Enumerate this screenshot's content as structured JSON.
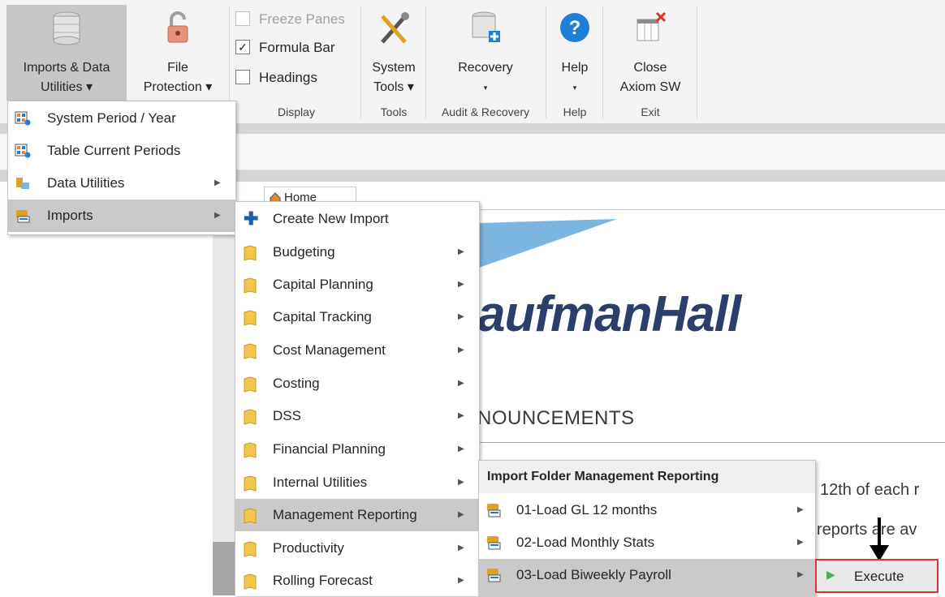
{
  "ribbon": {
    "imports_button": {
      "line1": "Imports & Data",
      "line2": "Utilities ▾",
      "icon": "database-icon"
    },
    "file_protection_button": {
      "line1": "File",
      "line2": "Protection ▾",
      "icon": "lock-icon"
    },
    "display": {
      "freeze_panes": {
        "label": "Freeze Panes",
        "checked": false
      },
      "formula_bar": {
        "label": "Formula Bar",
        "checked": true
      },
      "headings": {
        "label": "Headings",
        "checked": false
      },
      "group_label": "Display"
    },
    "system_tools_button": {
      "line1": "System",
      "line2": "Tools ▾",
      "icon": "tools-icon"
    },
    "tools_group_label": "Tools",
    "recovery_button": {
      "line1": "Recovery",
      "line2": "▾",
      "icon": "database-plus-icon"
    },
    "audit_group_label": "Audit & Recovery",
    "help_button": {
      "line1": "Help",
      "line2": "▾",
      "icon": "help-icon"
    },
    "help_group_label": "Help",
    "close_button": {
      "line1": "Close",
      "line2": "Axiom SW",
      "icon": "close-table-icon"
    },
    "exit_group_label": "Exit"
  },
  "content": {
    "home_tab": "Home",
    "logo_text": "aufmanHall",
    "announcements_title": "NOUNCEMENTS",
    "line1": "12th of each r",
    "line2": "reports are av"
  },
  "menu1": {
    "items": [
      {
        "label": "System Period / Year",
        "icon": "period-grid-icon",
        "submenu": false
      },
      {
        "label": "Table Current Periods",
        "icon": "period-grid-icon",
        "submenu": false
      },
      {
        "label": "Data Utilities",
        "icon": "data-utilities-icon",
        "submenu": true
      },
      {
        "label": "Imports",
        "icon": "imports-icon",
        "submenu": true,
        "selected": true
      }
    ]
  },
  "menu2": {
    "items": [
      {
        "label": "Create New Import",
        "icon": "plus-icon",
        "submenu": false
      },
      {
        "label": "Budgeting",
        "icon": "folder-icon",
        "submenu": true
      },
      {
        "label": "Capital Planning",
        "icon": "folder-icon",
        "submenu": true
      },
      {
        "label": "Capital Tracking",
        "icon": "folder-icon",
        "submenu": true
      },
      {
        "label": "Cost Management",
        "icon": "folder-icon",
        "submenu": true
      },
      {
        "label": "Costing",
        "icon": "folder-icon",
        "submenu": true
      },
      {
        "label": "DSS",
        "icon": "folder-icon",
        "submenu": true
      },
      {
        "label": "Financial Planning",
        "icon": "folder-icon",
        "submenu": true
      },
      {
        "label": "Internal Utilities",
        "icon": "folder-icon",
        "submenu": true
      },
      {
        "label": "Management Reporting",
        "icon": "folder-icon",
        "submenu": true,
        "selected": true
      },
      {
        "label": "Productivity",
        "icon": "folder-icon",
        "submenu": true
      },
      {
        "label": "Rolling Forecast",
        "icon": "folder-icon",
        "submenu": true
      }
    ]
  },
  "menu3": {
    "header": "Import Folder Management Reporting",
    "items": [
      {
        "label": "01-Load GL 12 months",
        "icon": "import-icon",
        "submenu": true
      },
      {
        "label": "02-Load Monthly Stats",
        "icon": "import-icon",
        "submenu": true
      },
      {
        "label": "03-Load Biweekly Payroll",
        "icon": "import-icon",
        "submenu": true,
        "selected": true
      }
    ]
  },
  "menu4": {
    "items": [
      {
        "label": "Execute",
        "icon": "play-icon"
      }
    ]
  },
  "colors": {
    "accent_blue": "#1e7fd8",
    "logo_navy": "#2c3e6a",
    "highlight_red": "#e03030",
    "menu_selected": "#c9c9c9"
  }
}
